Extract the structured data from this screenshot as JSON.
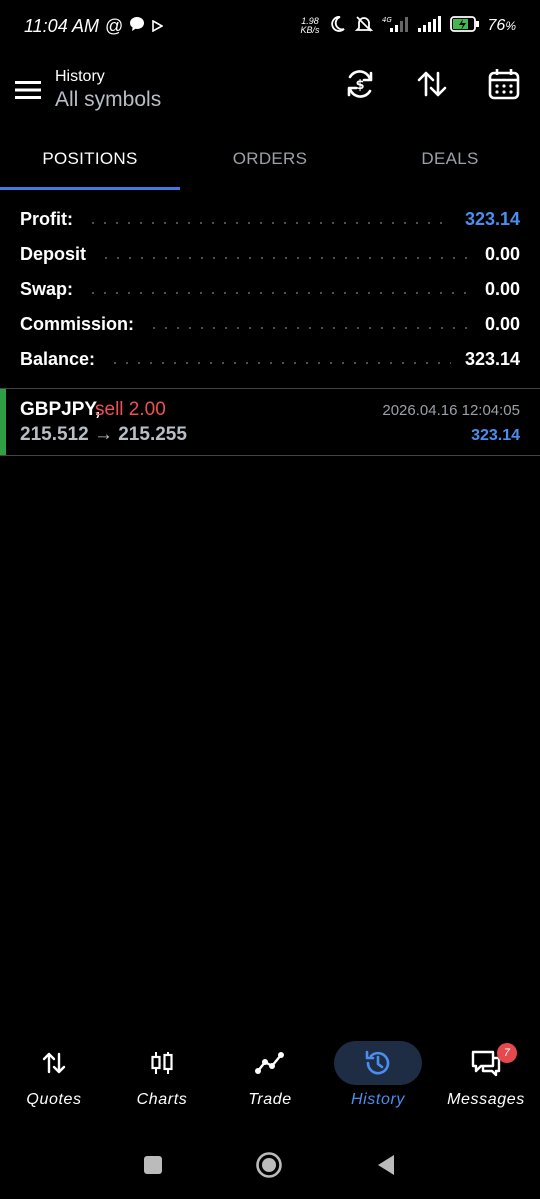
{
  "status_bar": {
    "time": "11:04 AM",
    "speed_top": "1.98",
    "speed_bottom": "KB/s",
    "battery": "76"
  },
  "header": {
    "title": "History",
    "subtitle": "All symbols"
  },
  "tabs": [
    {
      "label": "POSITIONS",
      "active": true
    },
    {
      "label": "ORDERS",
      "active": false
    },
    {
      "label": "DEALS",
      "active": false
    }
  ],
  "summary": {
    "profit_label": "Profit:",
    "profit_value": "323.14",
    "deposit_label": "Deposit",
    "deposit_value": "0.00",
    "swap_label": "Swap:",
    "swap_value": "0.00",
    "commission_label": "Commission:",
    "commission_value": "0.00",
    "balance_label": "Balance:",
    "balance_value": "323.14"
  },
  "deal": {
    "symbol": "GBPJPY,",
    "type": "sell 2.00",
    "prices": "215.512 → 215.255",
    "time": "2026.04.16 12:04:05",
    "profit": "323.14"
  },
  "bottom_nav": [
    {
      "label": "Quotes",
      "icon": "sort-arrows-icon"
    },
    {
      "label": "Charts",
      "icon": "candlestick-icon"
    },
    {
      "label": "Trade",
      "icon": "trend-line-icon"
    },
    {
      "label": "History",
      "icon": "history-clock-icon"
    },
    {
      "label": "Messages",
      "icon": "chat-icon",
      "badge": "7"
    }
  ],
  "colors": {
    "accent": "#3d7be0",
    "profit_blue": "#4a8ff0",
    "sell_red": "#ee5151",
    "deal_bar_green": "#2ea043"
  }
}
